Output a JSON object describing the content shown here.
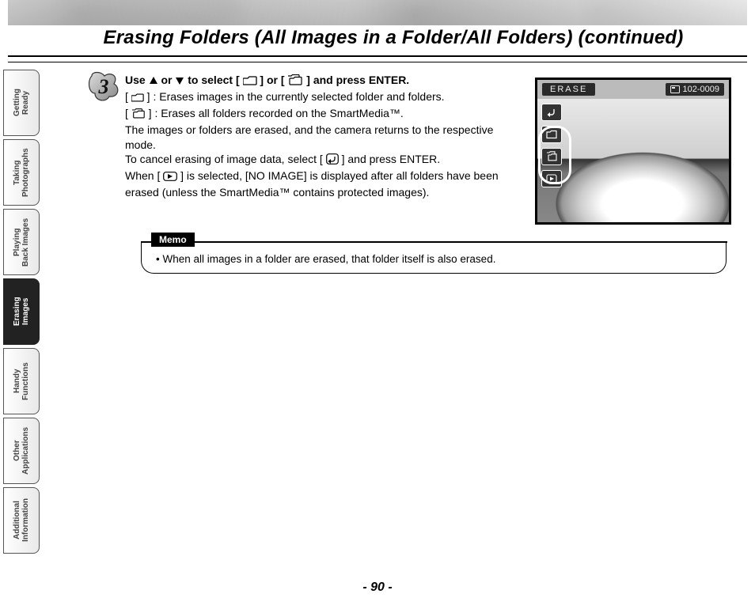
{
  "title": "Erasing Folders (All Images in a Folder/All Folders) (continued)",
  "sidebar": {
    "tabs": [
      {
        "l1": "Getting",
        "l2": "Ready",
        "active": false
      },
      {
        "l1": "Taking",
        "l2": "Photographs",
        "active": false
      },
      {
        "l1": "Playing",
        "l2": "Back Images",
        "active": false
      },
      {
        "l1": "Erasing",
        "l2": "Images",
        "active": true
      },
      {
        "l1": "Handy",
        "l2": "Functions",
        "active": false
      },
      {
        "l1": "Other",
        "l2": "Applications",
        "active": false
      },
      {
        "l1": "Additional",
        "l2": "Information",
        "active": false
      }
    ]
  },
  "step": {
    "number_icon": "step-3-icon",
    "heading_parts": {
      "a": "Use ",
      "b": " or ",
      "c": " to select [ ",
      "d": " ] or [ ",
      "e": " ] and press ENTER."
    },
    "body_parts": {
      "l1a": "[ ",
      "l1b": " ] : Erases images in the currently selected folder and folders.",
      "l2a": "[ ",
      "l2b": " ] : Erases all folders recorded on the SmartMedia™.",
      "l3": "The images or folders are erased, and the camera returns to the respective mode.",
      "l4a": "To cancel erasing of image data, select [ ",
      "l4b": " ] and press ENTER.",
      "l5a": "When [ ",
      "l5b": " ] is selected, [NO IMAGE] is displayed after all folders have been erased (unless the SmartMedia™ contains protected images)."
    }
  },
  "lcd": {
    "label": "ERASE",
    "file": "102-0009",
    "icons": [
      "return-icon",
      "single-folder-icon",
      "multi-folder-icon",
      "play-icon"
    ]
  },
  "memo": {
    "label": "Memo",
    "text": "When all images in a folder are erased, that folder itself is also erased."
  },
  "page_number": "- 90 -"
}
